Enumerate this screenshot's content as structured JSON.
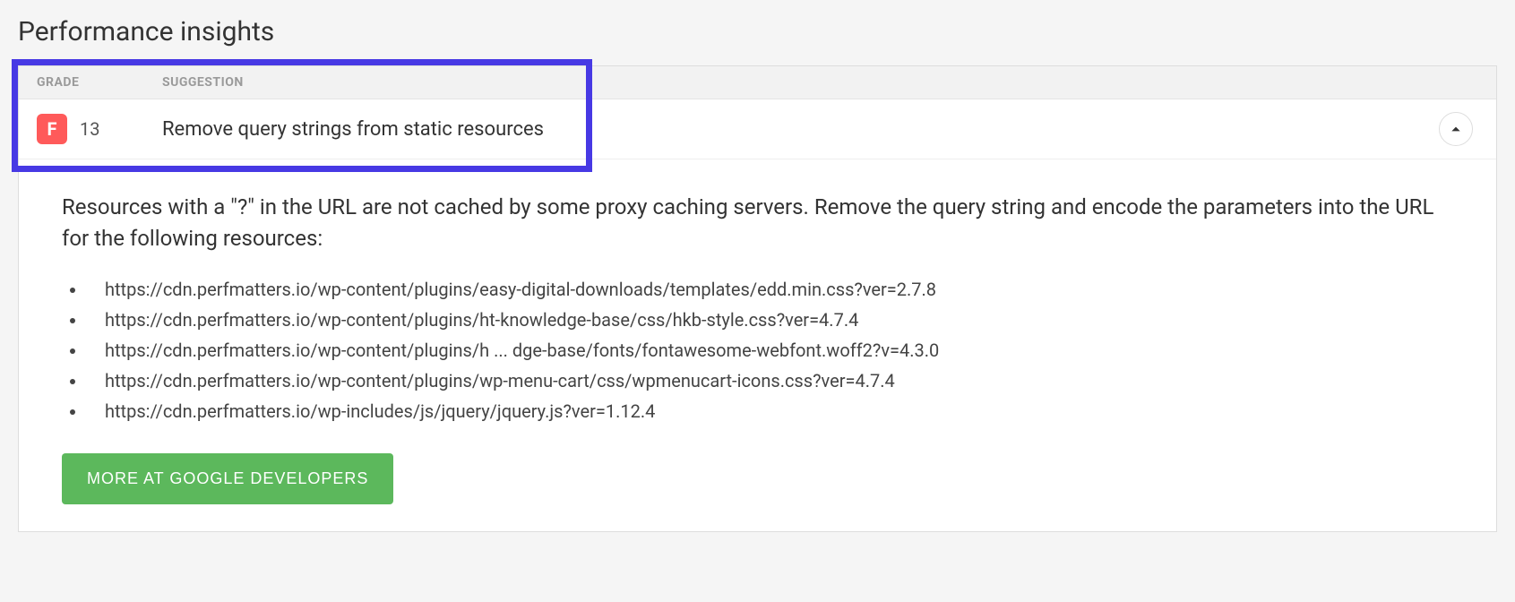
{
  "title": "Performance insights",
  "headers": {
    "grade": "GRADE",
    "suggestion": "SUGGESTION"
  },
  "insight": {
    "grade_letter": "F",
    "grade_score": "13",
    "suggestion": "Remove query strings from static resources"
  },
  "details": {
    "description": "Resources with a \"?\" in the URL are not cached by some proxy caching servers. Remove the query string and encode the parameters into the URL for the following resources:",
    "resources": [
      "https://cdn.perfmatters.io/wp-content/plugins/easy-digital-downloads/templates/edd.min.css?ver=2.7.8",
      "https://cdn.perfmatters.io/wp-content/plugins/ht-knowledge-base/css/hkb-style.css?ver=4.7.4",
      "https://cdn.perfmatters.io/wp-content/plugins/h ... dge-base/fonts/fontawesome-webfont.woff2?v=4.3.0",
      "https://cdn.perfmatters.io/wp-content/plugins/wp-menu-cart/css/wpmenucart-icons.css?ver=4.7.4",
      "https://cdn.perfmatters.io/wp-includes/js/jquery/jquery.js?ver=1.12.4"
    ],
    "cta_label": "MORE AT GOOGLE DEVELOPERS"
  },
  "colors": {
    "grade_badge_bg": "#ff5a5a",
    "highlight_border": "#4739e4",
    "cta_bg": "#5cb85c"
  }
}
